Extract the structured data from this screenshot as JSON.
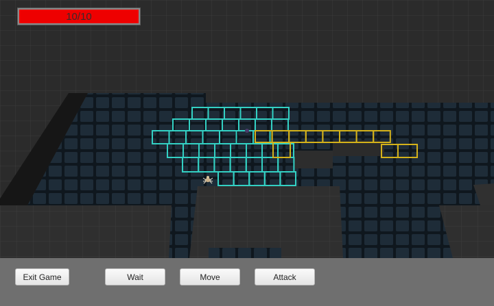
{
  "hud": {
    "health": {
      "text": "10/10",
      "current": 10,
      "max": 10,
      "fill_color": "#ee0000"
    }
  },
  "actions": {
    "exit_label": "Exit Game",
    "wait_label": "Wait",
    "move_label": "Move",
    "attack_label": "Attack"
  },
  "scene": {
    "move_highlight_color": "#33d1c4",
    "attack_highlight_color": "#d4b21a",
    "floor_tile_color": "#1e2c38",
    "wall_color": "#2e2e2e",
    "player_icon": "spider-icon"
  }
}
